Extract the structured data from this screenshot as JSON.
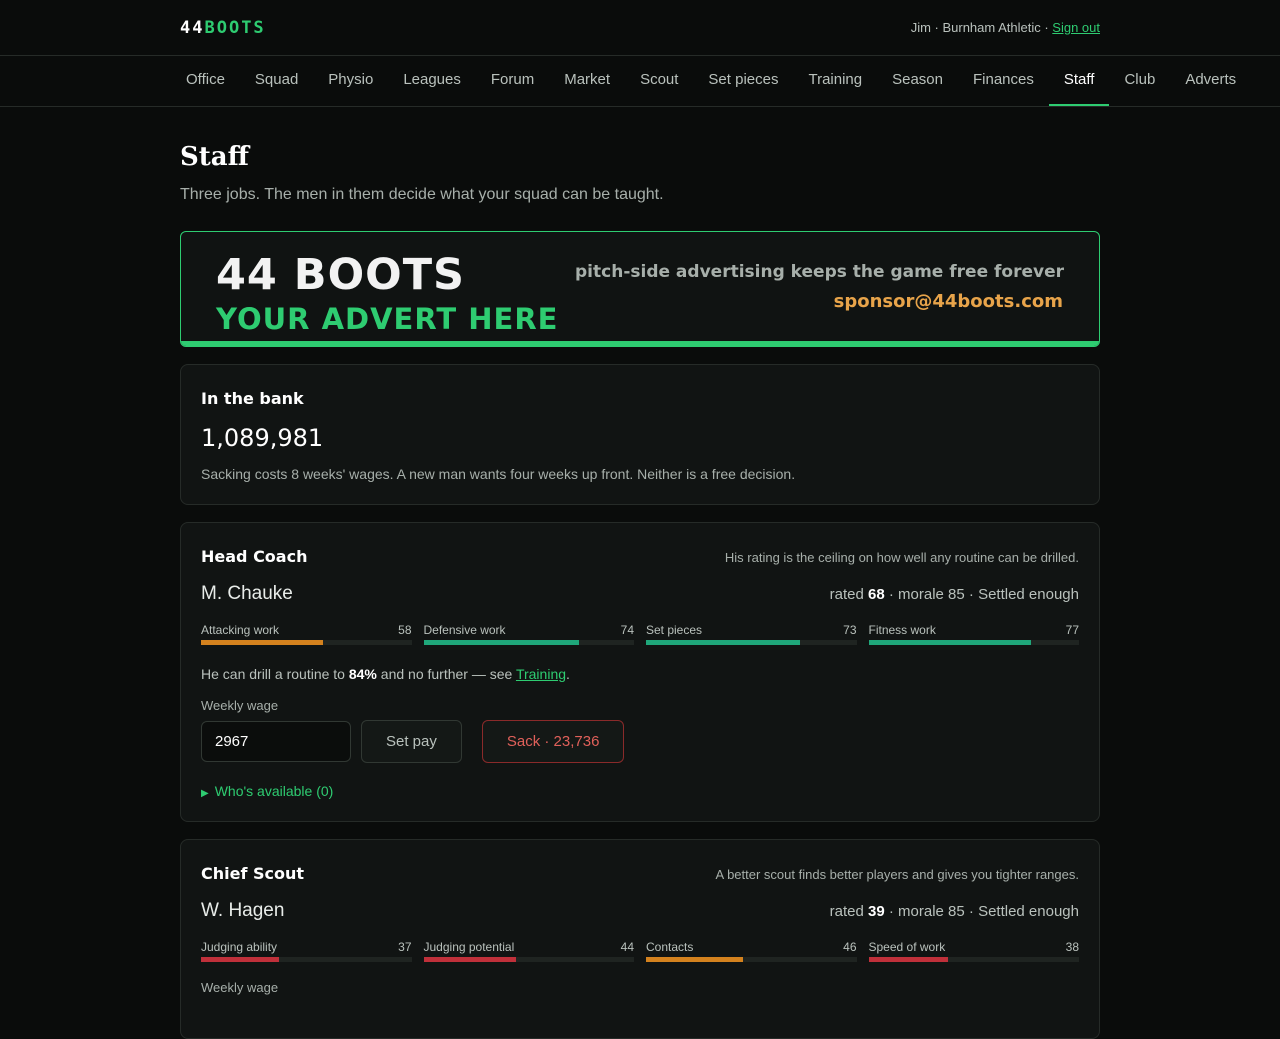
{
  "brand": {
    "prefix": "44",
    "suffix": "BOOTS"
  },
  "user": {
    "info": "Jim · Burnham Athletic · ",
    "signout": "Sign out"
  },
  "nav": [
    "Office",
    "Squad",
    "Physio",
    "Leagues",
    "Forum",
    "Market",
    "Scout",
    "Set pieces",
    "Training",
    "Season",
    "Finances",
    "Staff",
    "Club",
    "Adverts"
  ],
  "nav_active": "Staff",
  "page": {
    "title": "Staff",
    "subtitle": "Three jobs. The men in them decide what your squad can be taught."
  },
  "advert": {
    "brand": "44 BOOTS",
    "slogan": "YOUR ADVERT HERE",
    "tagline": "pitch-side advertising keeps the game free forever",
    "email": "sponsor@44boots.com"
  },
  "bank": {
    "title": "In the bank",
    "amount": "1,089,981",
    "note": "Sacking costs 8 weeks' wages. A new man wants four weeks up front. Neither is a free decision."
  },
  "colors": {
    "accent": "#2ecc71",
    "good": "#1fa77a",
    "mid": "#d4821e",
    "bad": "#c0303a"
  },
  "head_coach": {
    "title": "Head Coach",
    "hint": "His rating is the ceiling on how well any routine can be drilled.",
    "name": "M. Chauke",
    "meta_prefix": "rated ",
    "rating": "68",
    "meta_suffix": " · morale 85 · Settled enough",
    "attrs": [
      {
        "label": "Attacking work",
        "value": 58,
        "tone": "mid"
      },
      {
        "label": "Defensive work",
        "value": 74,
        "tone": "good"
      },
      {
        "label": "Set pieces",
        "value": 73,
        "tone": "good"
      },
      {
        "label": "Fitness work",
        "value": 77,
        "tone": "good"
      }
    ],
    "drill_prefix": "He can drill a routine to ",
    "drill_value": "84%",
    "drill_mid": " and no further — see ",
    "drill_link": "Training",
    "drill_end": ".",
    "wage_label": "Weekly wage",
    "wage_value": "2967",
    "setpay_label": "Set pay",
    "sack_label": "Sack · 23,736",
    "available_label": "Who's available (0)"
  },
  "chief_scout": {
    "title": "Chief Scout",
    "hint": "A better scout finds better players and gives you tighter ranges.",
    "name": "W. Hagen",
    "meta_prefix": "rated ",
    "rating": "39",
    "meta_suffix": " · morale 85 · Settled enough",
    "attrs": [
      {
        "label": "Judging ability",
        "value": 37,
        "tone": "bad"
      },
      {
        "label": "Judging potential",
        "value": 44,
        "tone": "bad"
      },
      {
        "label": "Contacts",
        "value": 46,
        "tone": "mid"
      },
      {
        "label": "Speed of work",
        "value": 38,
        "tone": "bad"
      }
    ],
    "wage_label": "Weekly wage"
  }
}
